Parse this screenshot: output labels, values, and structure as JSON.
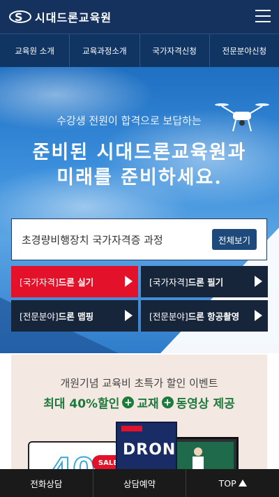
{
  "header": {
    "logo_text": "시대드론교육원"
  },
  "nav": {
    "items": [
      "교육원 소개",
      "교육과정소개",
      "국가자격신청",
      "전문분야신청"
    ]
  },
  "hero": {
    "subtitle": "수강생 전원이 합격으로 보답하는",
    "title_line1": "준비된 시대드론교육원과",
    "title_line2": "미래를 준비하세요."
  },
  "search": {
    "text": "초경량비행장치 국가자격증 과정",
    "button": "전체보기"
  },
  "courses": [
    {
      "prefix": "[국가자격]",
      "name": "드론 실기"
    },
    {
      "prefix": "[국가자격]",
      "name": "드론 필기"
    },
    {
      "prefix": "[전문분야]",
      "name": "드론 맵핑"
    },
    {
      "prefix": "[전문분야]",
      "name": "드론 항공촬영"
    }
  ],
  "promo": {
    "line1": "개원기념 교육비 초특가 할인 이벤트",
    "highlight": "최대 40%할인",
    "item2": "교재",
    "item3": "동영상 제공",
    "coupon_number": "40",
    "coupon_tag": "SALE",
    "book_word": "DRON"
  },
  "bottom_bar": {
    "call": "전화상담",
    "reserve": "상담예약",
    "top": "TOP"
  },
  "colors": {
    "header_bg": "#14325d",
    "nav_bg": "#113563",
    "accent_red": "#e3122a",
    "course_dark": "#17253a",
    "promo_green": "#1c7a3c"
  }
}
